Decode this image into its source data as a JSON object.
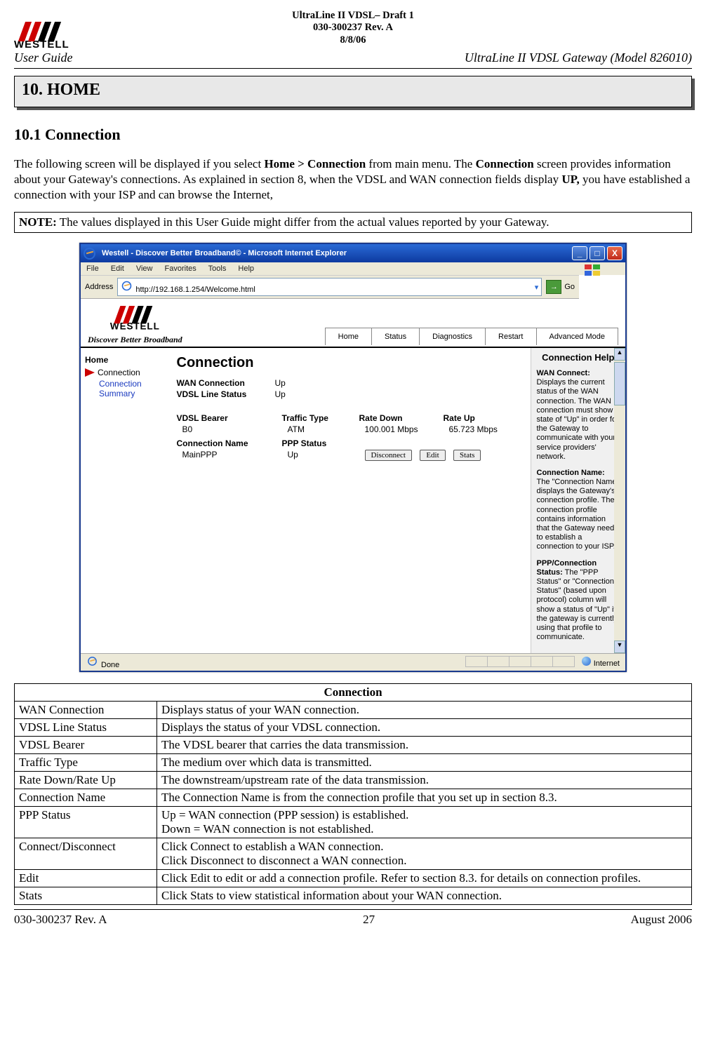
{
  "doc_header": {
    "line1": "UltraLine II VDSL– Draft 1",
    "line2": "030-300237 Rev. A",
    "line3": "8/8/06"
  },
  "brand": {
    "name": "WESTELL"
  },
  "running_left": "User Guide",
  "running_right": "UltraLine II VDSL Gateway (Model 826010)",
  "section_banner": "10. HOME",
  "subsection": "10.1 Connection",
  "body_para": {
    "pre1": "The following screen will be displayed if you select ",
    "b1": "Home > Connection",
    "mid1": " from main menu. The ",
    "b2": "Connection",
    "mid2": " screen provides information about your Gateway's connections. As explained in section 8, when the VDSL and WAN connection fields display ",
    "b3": "UP,",
    "post": " you have established a connection with your ISP and can browse the Internet,"
  },
  "note": {
    "label": "NOTE:",
    "text": " The values displayed in this User Guide might differ from the actual values reported by your Gateway."
  },
  "shot": {
    "window_title": "Westell - Discover Better Broadband© - Microsoft Internet Explorer",
    "menus": [
      "File",
      "Edit",
      "View",
      "Favorites",
      "Tools",
      "Help"
    ],
    "address_label": "Address",
    "url": "http://192.168.1.254/Welcome.html",
    "go": "Go",
    "slogan": "Discover Better Broadband",
    "nav": [
      "Home",
      "Status",
      "Diagnostics",
      "Restart",
      "Advanced Mode"
    ],
    "sidebar": {
      "group": "Home",
      "active": "Connection",
      "link": "Connection Summary"
    },
    "panel_title": "Connection",
    "wan_label": "WAN Connection",
    "wan_value": "Up",
    "vdsl_label": "VDSL Line Status",
    "vdsl_value": "Up",
    "cols": {
      "c1": "VDSL Bearer",
      "c2": "Traffic Type",
      "c3": "Rate Down",
      "c4": "Rate Up"
    },
    "row1": {
      "c1": "B0",
      "c2": "ATM",
      "c3": "100.001 Mbps",
      "c4": "65.723 Mbps"
    },
    "cols2": {
      "c1": "Connection Name",
      "c2": "PPP Status"
    },
    "row2": {
      "c1": "MainPPP",
      "c2": "Up"
    },
    "btn_disconnect": "Disconnect",
    "btn_edit": "Edit",
    "btn_stats": "Stats",
    "help": {
      "title": "Connection Help",
      "wan_head": "WAN Connect:",
      "wan_text": " Displays the current status of the WAN connection. The WAN connection must show a state of \"Up\" in order for the Gateway to communicate with your service providers' network.",
      "cn_head": "Connection Name:",
      "cn_text": " The \"Connection Name\" displays the Gateway's connection profile. The connection profile contains information that the Gateway needs to establish a connection to your ISP.",
      "ppp_head": "PPP/Connection Status:",
      "ppp_text": " The \"PPP Status\" or \"Connection Status\" (based upon protocol) column will show a status of \"Up\" if the gateway is currently using that profile to communicate."
    },
    "status_done": "Done",
    "status_internet": "Internet"
  },
  "desc": {
    "title": "Connection",
    "rows": [
      {
        "k": "WAN Connection",
        "v": "Displays status of your WAN connection."
      },
      {
        "k": "VDSL Line Status",
        "v": "Displays the status of your VDSL connection."
      },
      {
        "k": "VDSL Bearer",
        "v": "The VDSL bearer that carries the data transmission."
      },
      {
        "k": "Traffic Type",
        "v": "The medium over which data is transmitted."
      },
      {
        "k": "Rate Down/Rate Up",
        "v": "The downstream/upstream rate of the data transmission."
      },
      {
        "k": "Connection Name",
        "v": "The Connection Name is from the connection profile that you set up in section 8.3."
      },
      {
        "k": "PPP Status",
        "v": "Up = WAN connection (PPP session) is established.\nDown = WAN connection is not established."
      },
      {
        "k": "Connect/Disconnect",
        "v": "Click Connect to establish a WAN connection.\nClick Disconnect to disconnect a WAN connection."
      },
      {
        "k": "Edit",
        "v": "Click Edit to edit or add a connection profile. Refer to section 8.3. for details on connection profiles."
      },
      {
        "k": "Stats",
        "v": "Click Stats to view statistical information about your WAN connection."
      }
    ]
  },
  "footer": {
    "left": "030-300237 Rev. A",
    "center": "27",
    "right": "August 2006"
  }
}
